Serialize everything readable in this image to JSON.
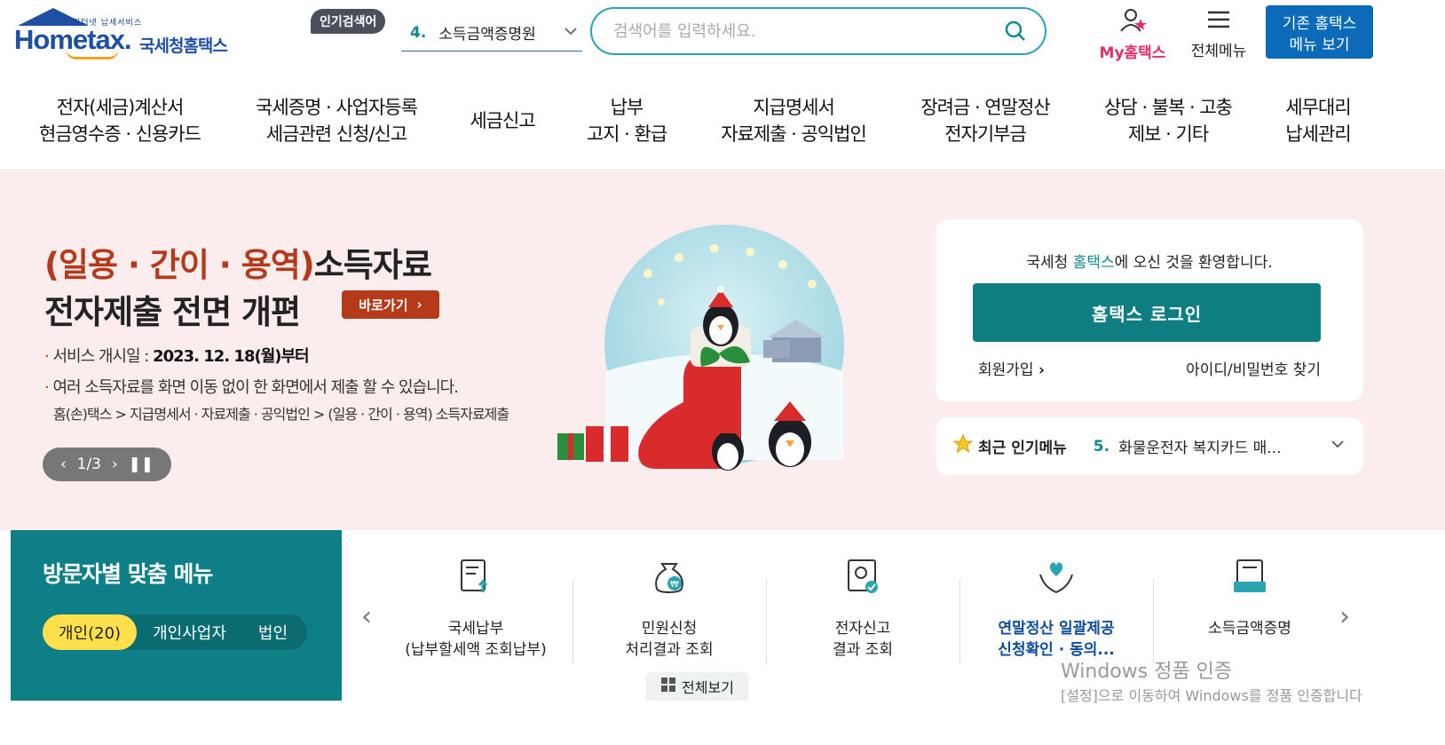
{
  "header": {
    "logo_small": "인터넷 납세서비스",
    "logo_home": "Hometax.",
    "logo_kor": "국세청홈택스",
    "popular_tag": "인기검색어",
    "popular_num": "4.",
    "popular_term": "소득금액증명원",
    "search_placeholder": "검색어를 입력하세요.",
    "my_label": "My홈택스",
    "allmenu_label": "전체메뉴",
    "old_btn_line1": "기존 홈택스",
    "old_btn_line2": "메뉴 보기"
  },
  "gnb": [
    {
      "l1": "전자(세금)계산서",
      "l2": "현금영수증 · 신용카드"
    },
    {
      "l1": "국세증명 · 사업자등록",
      "l2": "세금관련 신청/신고"
    },
    {
      "l1": "세금신고",
      "l2": ""
    },
    {
      "l1": "납부",
      "l2": "고지 · 환급"
    },
    {
      "l1": "지급명세서",
      "l2": "자료제출 · 공익법인"
    },
    {
      "l1": "장려금 · 연말정산",
      "l2": "전자기부금"
    },
    {
      "l1": "상담 · 불복 · 고충",
      "l2": "제보 · 기타"
    },
    {
      "l1": "세무대리",
      "l2": "납세관리"
    }
  ],
  "banner": {
    "title_red": "(일용 · 간이 · 용역)",
    "title_rest": "소득자료",
    "title2": "전자제출 전면 개편",
    "goto": "바로가기",
    "line1_label": "서비스 개시일 : ",
    "line1_value": "2023. 12. 18(월)부터",
    "line2": "여러 소득자료를 화면 이동 없이 한 화면에서 제출 할 수 있습니다.",
    "line3": "홈(손)택스 > 지급명세서 · 자료제출 · 공익법인 > (일용 · 간이 · 용역) 소득자료제출",
    "slide": "1/3"
  },
  "login": {
    "welcome_pre": "국세청 ",
    "welcome_brand": "홈택스",
    "welcome_post": "에 오신 것을 환영합니다.",
    "login_btn": "홈택스 로그인",
    "join": "회원가입",
    "find": "아이디/비밀번호 찾기"
  },
  "recent": {
    "title": "최근 인기메뉴",
    "num": "5.",
    "item": "화물운전자 복지카드 매..."
  },
  "visitor": {
    "title": "방문자별 맞춤 메뉴",
    "tabs": [
      "개인(20)",
      "개인사업자",
      "법인"
    ]
  },
  "quick": {
    "items": [
      {
        "l1": "국세납부",
        "l2": "(납부할세액 조회납부)"
      },
      {
        "l1": "민원신청",
        "l2": "처리결과 조회"
      },
      {
        "l1": "전자신고",
        "l2": "결과 조회"
      },
      {
        "l1": "연말정산 일괄제공",
        "l2": "신청확인 · 동의..."
      },
      {
        "l1": "소득금액증명",
        "l2": ""
      }
    ],
    "allview": "전체보기"
  },
  "watermark": {
    "line1": "Windows 정품 인증",
    "line2": "[설정]으로 이동하여 Windows를 정품 인증합니다"
  },
  "colors": {
    "teal": "#0f7e82",
    "brand_blue": "#1e4fa5",
    "accent_red": "#b53a1a",
    "banner_bg": "#fbeced"
  }
}
